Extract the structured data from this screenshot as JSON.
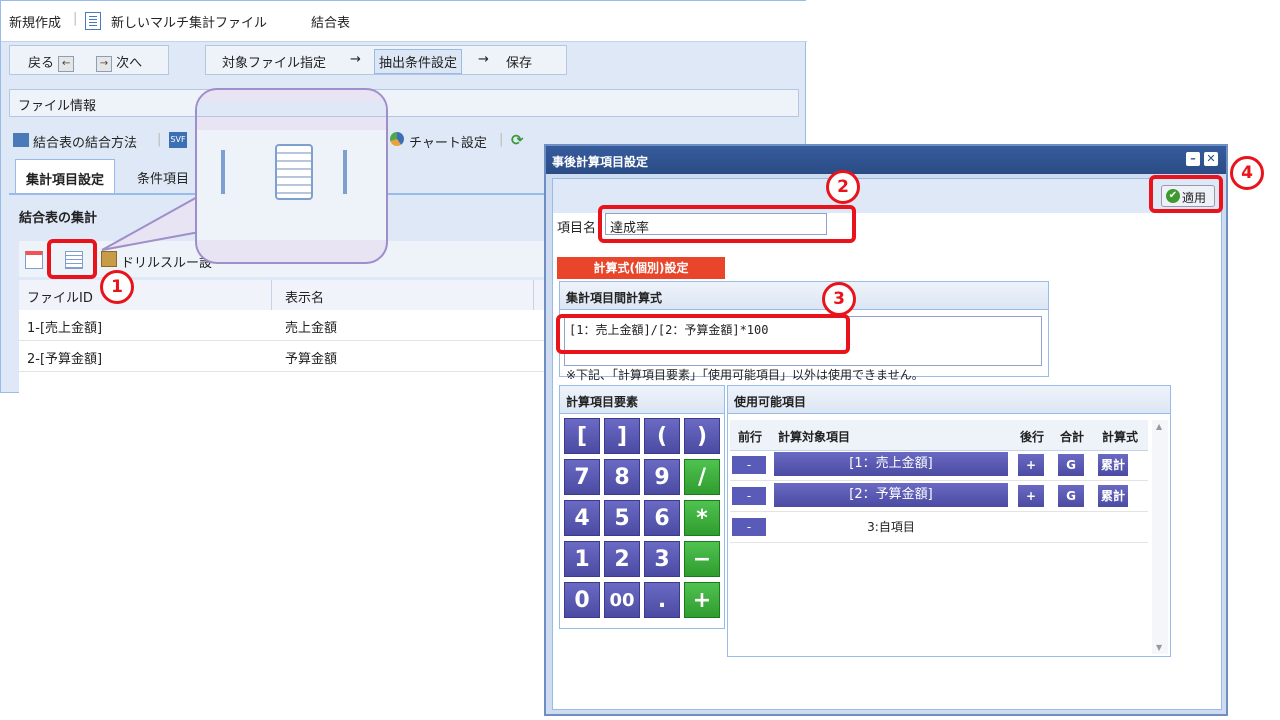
{
  "main_window": {
    "title_new": "新規作成",
    "file_title": "新しいマルチ集計ファイル",
    "file_type": "結合表",
    "nav": {
      "back": "戻る",
      "next": "次へ",
      "step1": "対象ファイル指定",
      "arrow": "→",
      "step2": "抽出条件設定",
      "step3": "保存"
    },
    "file_info": "ファイル情報",
    "toolbar": {
      "join_method": "結合表の結合方法",
      "chart_settings": "チャート設定"
    },
    "tabs": [
      "集計項目設定",
      "条件項目"
    ],
    "section_title": "結合表の集計",
    "drill_label": "ドリルスルー設",
    "grid": {
      "columns": [
        "ファイルID",
        "表示名"
      ],
      "rows": [
        {
          "file_id": "1-[売上金額]",
          "name": "売上金額"
        },
        {
          "file_id": "2-[予算金額]",
          "name": "予算金額"
        }
      ]
    }
  },
  "dialog": {
    "title": "事後計算項目設定",
    "apply_label": "適用",
    "item_name_label": "項目名",
    "item_name_value": "達成率",
    "formula_tab": "計算式(個別)設定",
    "formula_panel_title": "集計項目間計算式",
    "formula_value": "[1：売上金額]/[2：予算金額]*100",
    "note": "※下記、「計算項目要素」「使用可能項目」以外は使用できません。",
    "elements_title": "計算項目要素",
    "keypad": [
      [
        "[",
        "]",
        "(",
        ")"
      ],
      [
        "7",
        "8",
        "9",
        "/"
      ],
      [
        "4",
        "5",
        "6",
        "*"
      ],
      [
        "1",
        "2",
        "3",
        "−"
      ],
      [
        "0",
        "00",
        ".",
        "+"
      ]
    ],
    "available_title": "使用可能項目",
    "table_headers": {
      "prev": "前行",
      "target": "計算対象項目",
      "next": "後行",
      "total": "合計",
      "formula": "計算式"
    },
    "items": [
      {
        "minus": "-",
        "label": "[1：売上金額]",
        "plus": "+",
        "g": "G",
        "cum": "累計"
      },
      {
        "minus": "-",
        "label": "[2：予算金額]",
        "plus": "+",
        "g": "G",
        "cum": "累計"
      },
      {
        "minus": "-",
        "label": "3:自項目"
      }
    ]
  },
  "annotations": {
    "n1": "1",
    "n2": "2",
    "n3": "3",
    "n4": "4"
  },
  "colors": {
    "highlight_red": "#e8131b",
    "dialog_title_blue": "#2a4c86",
    "key_purple": "#4b4ba3",
    "key_green": "#2f9d2f",
    "formula_tab_red": "#e8452a"
  }
}
